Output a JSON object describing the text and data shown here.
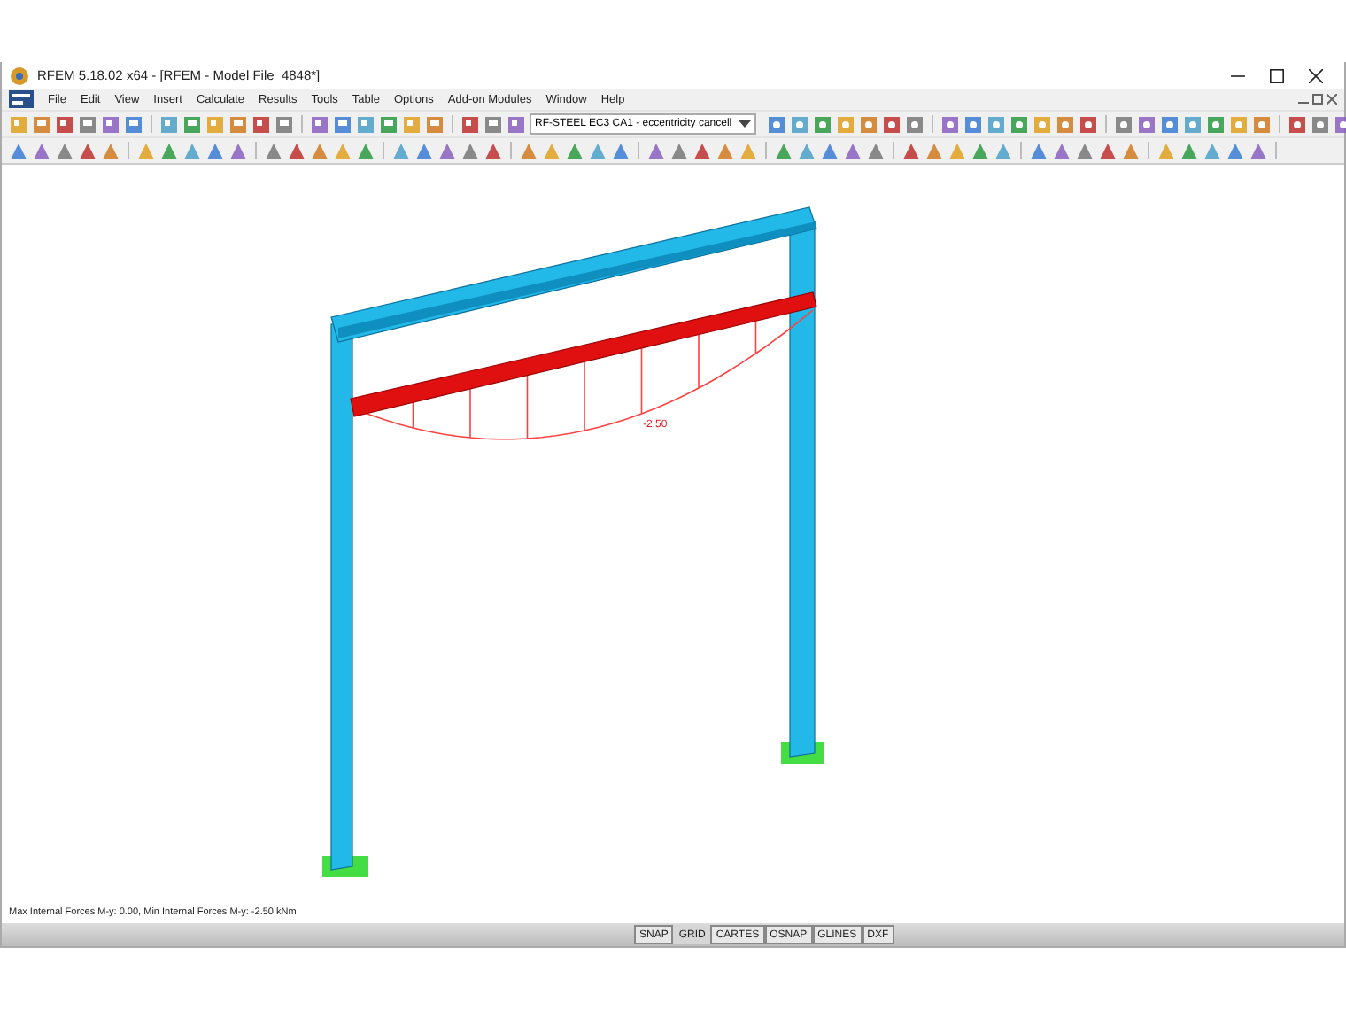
{
  "window": {
    "title": "RFEM 5.18.02 x64 - [RFEM - Model File_4848*]"
  },
  "menu": [
    "File",
    "Edit",
    "View",
    "Insert",
    "Calculate",
    "Results",
    "Tools",
    "Table",
    "Options",
    "Add-on Modules",
    "Window",
    "Help"
  ],
  "toolbar": {
    "case_selector": "RF-STEEL EC3 CA1 - eccentricity cancell"
  },
  "canvas": {
    "diagram_label": "-2.50",
    "info": "Max Internal Forces M-y: 0.00, Min Internal Forces M-y: -2.50 kNm"
  },
  "status_bar": [
    {
      "label": "SNAP",
      "on": false
    },
    {
      "label": "GRID",
      "on": true
    },
    {
      "label": "CARTES",
      "on": false
    },
    {
      "label": "OSNAP",
      "on": false
    },
    {
      "label": "GLINES",
      "on": false
    },
    {
      "label": "DXF",
      "on": false
    }
  ]
}
